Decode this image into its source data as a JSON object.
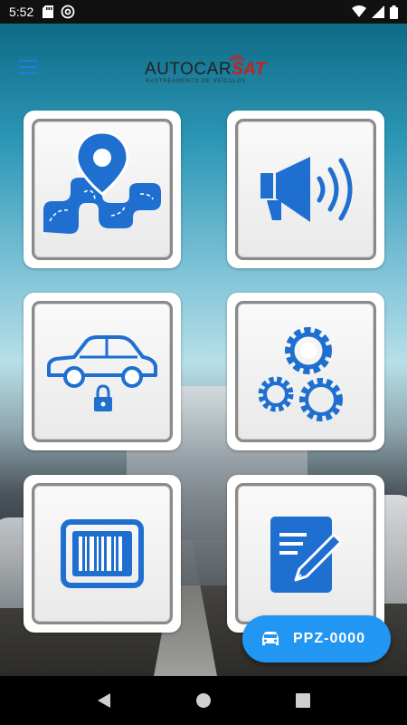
{
  "status_bar": {
    "time": "5:52",
    "left_icons": [
      "sd-card-icon",
      "at-sign-icon"
    ],
    "right_icons": [
      "wifi-icon",
      "signal-icon",
      "battery-icon"
    ]
  },
  "header": {
    "menu_icon": "hamburger-menu-icon",
    "logo": {
      "main_prefix": "AUTOCAR",
      "main_accent": "SAT",
      "subtitle": "RASTREAMENTO DE VEÍCULOS"
    }
  },
  "tiles": [
    {
      "icon": "map-route-icon"
    },
    {
      "icon": "speaker-icon"
    },
    {
      "icon": "car-lock-icon"
    },
    {
      "icon": "gears-icon"
    },
    {
      "icon": "barcode-icon"
    },
    {
      "icon": "edit-document-icon"
    }
  ],
  "fab": {
    "icon": "car-icon",
    "label": "PPZ-0000"
  },
  "nav_bar": {
    "buttons": [
      "back-icon",
      "home-icon",
      "recents-icon"
    ]
  },
  "colors": {
    "accent_blue": "#1e6fd0",
    "fab_blue": "#2196f3",
    "logo_red": "#d31b1b"
  }
}
